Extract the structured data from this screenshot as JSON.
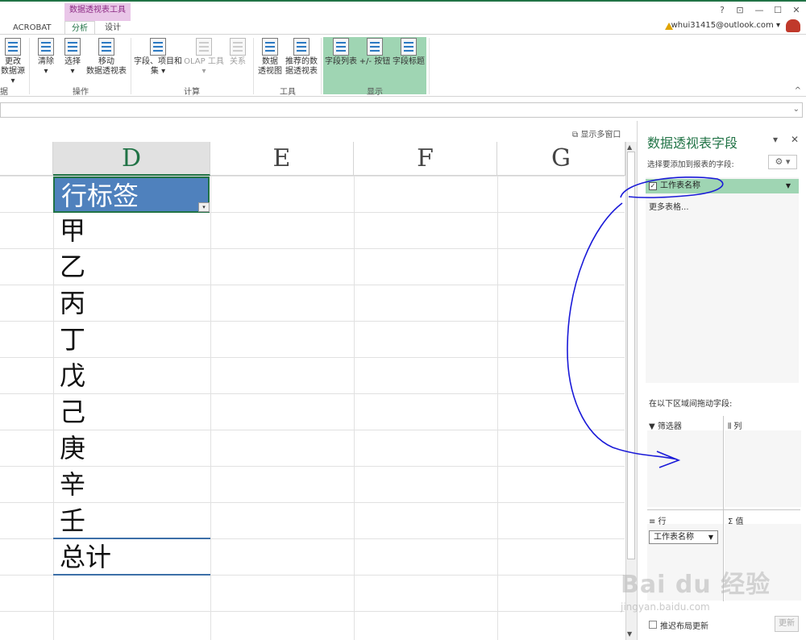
{
  "ribbon_context": {
    "title": "数据透视表工具"
  },
  "tabs": {
    "acrobat": "ACROBAT",
    "analyze": "分析",
    "design": "设计"
  },
  "window": {
    "help": "?",
    "restore_ribbon": "⊡",
    "minimize": "—",
    "maximize": "☐",
    "close": "✕",
    "account": "whui31415@outlook.com ▾"
  },
  "ribbon": {
    "change_source": "更改",
    "change_source2": "数据源 ▾",
    "clear": "清除",
    "select": "选择",
    "move": "移动",
    "move2": "数据透视表",
    "fields": "字段、项目和",
    "fields2": "集 ▾",
    "olap": "OLAP 工具",
    "relations": "关系",
    "pivot_chart": "数据",
    "pivot_chart2": "透视图",
    "recommended": "推荐的数",
    "recommended2": "据透视表",
    "field_list": "字段列表",
    "plus_minus": "+/- 按钮",
    "field_headers": "字段标题",
    "group_data_fragment": "据",
    "group_actions": "操作",
    "group_calc": "计算",
    "group_tools": "工具",
    "group_show": "显示",
    "collapse": "^"
  },
  "formula_bar": {
    "dropdown": "⌄"
  },
  "sheet": {
    "multi_window": "⧉ 显示多窗口",
    "columns": [
      "D",
      "E",
      "F",
      "G"
    ],
    "row_label": "行标签",
    "items": [
      "甲",
      "乙",
      "丙",
      "丁",
      "戊",
      "己",
      "庚",
      "辛",
      "壬"
    ],
    "total": "总计",
    "dropdown": "▾"
  },
  "pane": {
    "title": "数据透视表字段",
    "close": "✕",
    "dropdown": "▾",
    "subtitle": "选择要添加到报表的字段:",
    "gear": "⚙ ▾",
    "field": "工作表名称",
    "field_checked": "✓",
    "field_arrow": "▼",
    "more_tables": "更多表格...",
    "drag_title": "在以下区域间拖动字段:",
    "filters": "▼ 筛选器",
    "columns": "⫴ 列",
    "rows": "≡ 行",
    "values": "Σ 值",
    "row_chip": "工作表名称",
    "row_chip_arrow": "▼",
    "defer": "推迟布局更新",
    "update": "更新"
  },
  "watermark": {
    "logo": "Bai du 经验",
    "url": "jingyan.baidu.com"
  }
}
